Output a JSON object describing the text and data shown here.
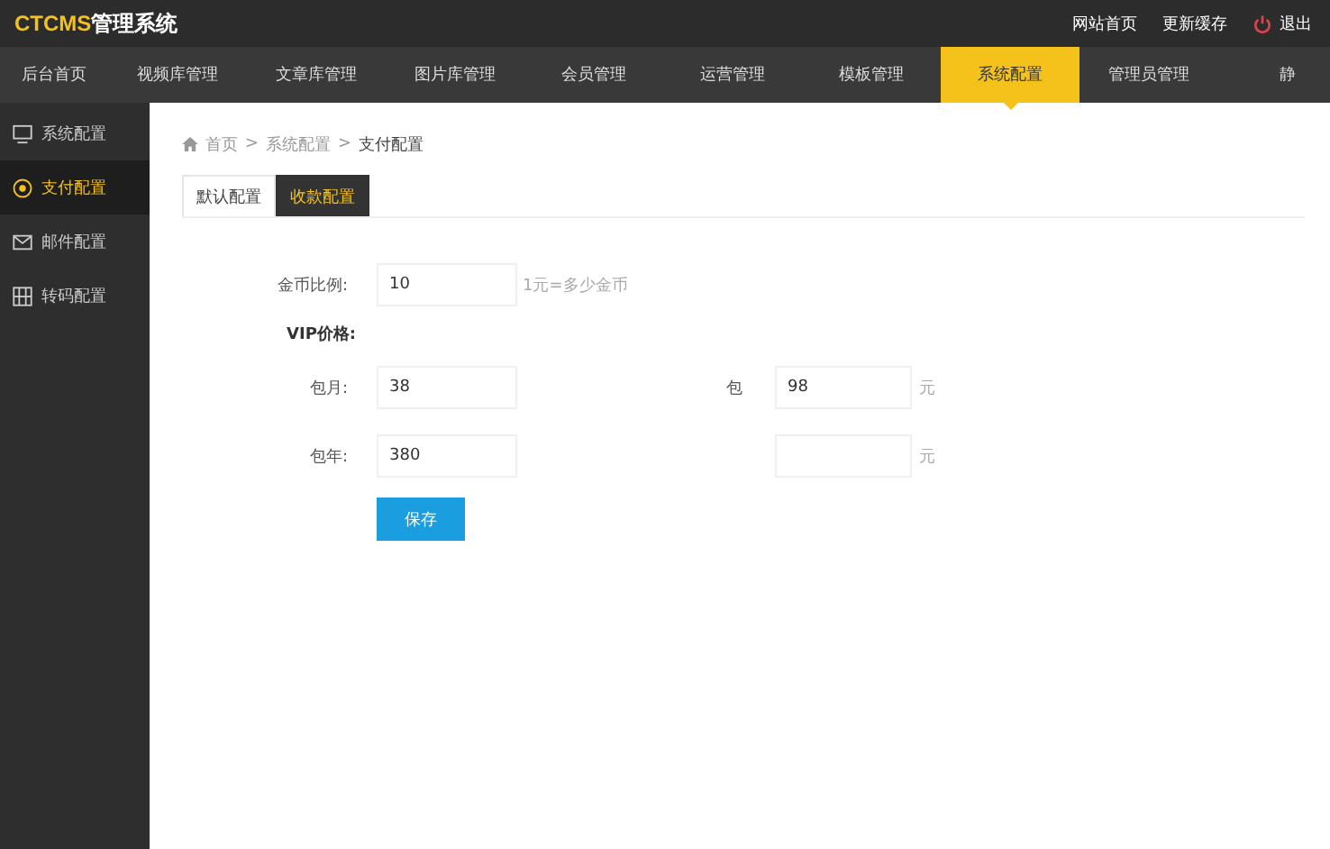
{
  "header": {
    "logo_accent": "CTCMS",
    "logo_rest": "管理系统",
    "links": [
      {
        "label": "网站首页",
        "kind": "text"
      },
      {
        "label": "更新缓存",
        "kind": "text"
      },
      {
        "label": "退出",
        "kind": "logout"
      }
    ]
  },
  "nav": [
    {
      "label": "后台首页",
      "selected": false
    },
    {
      "label": "视频库管理",
      "selected": false
    },
    {
      "label": "文章库管理",
      "selected": false
    },
    {
      "label": "图片库管理",
      "selected": false
    },
    {
      "label": "会员管理",
      "selected": false
    },
    {
      "label": "运营管理",
      "selected": false
    },
    {
      "label": "模板管理",
      "selected": false
    },
    {
      "label": "系统配置",
      "selected": true
    },
    {
      "label": "管理员管理",
      "selected": false
    },
    {
      "label": "静",
      "selected": false
    }
  ],
  "sidebar": [
    {
      "label": "系统配置",
      "kind": "monitor",
      "selected": false
    },
    {
      "label": "支付配置",
      "kind": "coin",
      "selected": true
    },
    {
      "label": "邮件配置",
      "kind": "mail",
      "selected": false
    },
    {
      "label": "转码配置",
      "kind": "grid",
      "selected": false
    }
  ],
  "breadcrumb": [
    {
      "kind": "link",
      "text": "首页"
    },
    {
      "kind": "sep",
      "text": ">"
    },
    {
      "kind": "link",
      "text": "系统配置"
    },
    {
      "kind": "sep",
      "text": ">"
    },
    {
      "kind": "current",
      "text": "支付配置"
    }
  ],
  "tabs": [
    {
      "label": "默认配置",
      "selected": false
    },
    {
      "label": "收款配置",
      "selected": true
    }
  ],
  "form": {
    "coin_ratio": {
      "label": "金币比例:",
      "value": "10",
      "hint": "1元=多少金币"
    },
    "vip_heading": "VIP价格:",
    "rows": [
      {
        "label": "包月:",
        "value": "38",
        "right_label": "包",
        "right_value": "98",
        "unit": "元"
      },
      {
        "label": "包年:",
        "value": "380",
        "unit": "元"
      }
    ],
    "save": "保存"
  }
}
